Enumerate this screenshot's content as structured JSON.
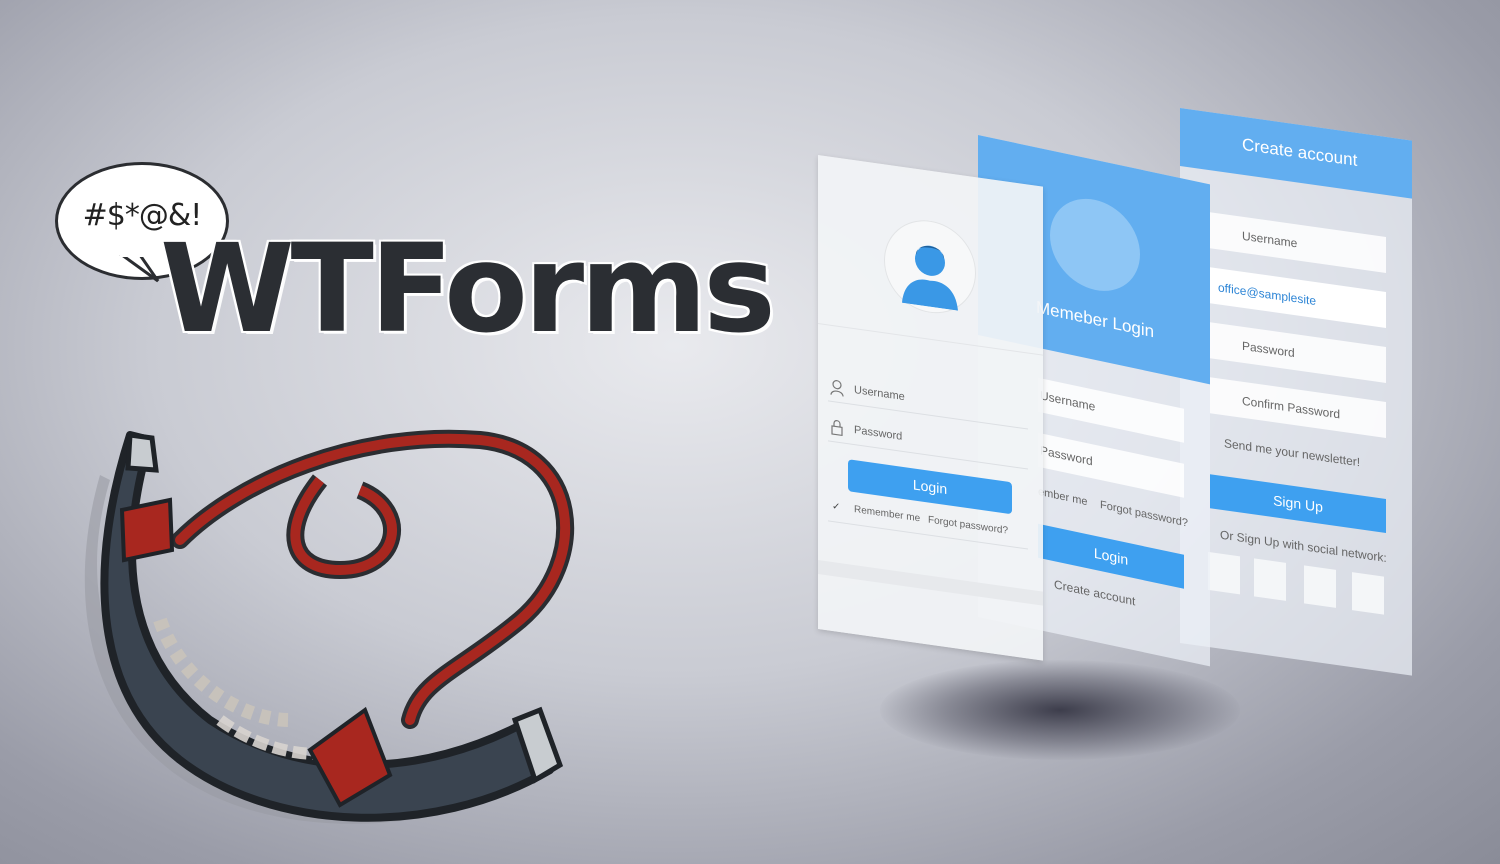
{
  "bubble": {
    "text": "#$*@&!"
  },
  "title": "WTForms",
  "form_login": {
    "username_label": "Username",
    "password_label": "Password",
    "login_button": "Login",
    "remember_label": "Remember me",
    "forgot_label": "Forgot password?"
  },
  "form_member": {
    "header": "Memeber Login",
    "username_label": "Username",
    "password_label": "Password",
    "remember_label": "ember me",
    "forgot_label": "Forgot password?",
    "login_button": "Login",
    "create_link": "Create account"
  },
  "form_signup": {
    "header": "Create account",
    "username_label": "Username",
    "email_value": "office@samplesite",
    "password_label": "Password",
    "confirm_label": "Confirm Password",
    "newsletter_label": "Send me your newsletter!",
    "signup_button": "Sign Up",
    "social_label": "Or Sign Up with social network:"
  },
  "colors": {
    "accent": "#3ea0f0",
    "header": "#62aef0",
    "title": "#2b2e33",
    "horn_red": "#a8271f",
    "horn_dark": "#3a4450"
  }
}
